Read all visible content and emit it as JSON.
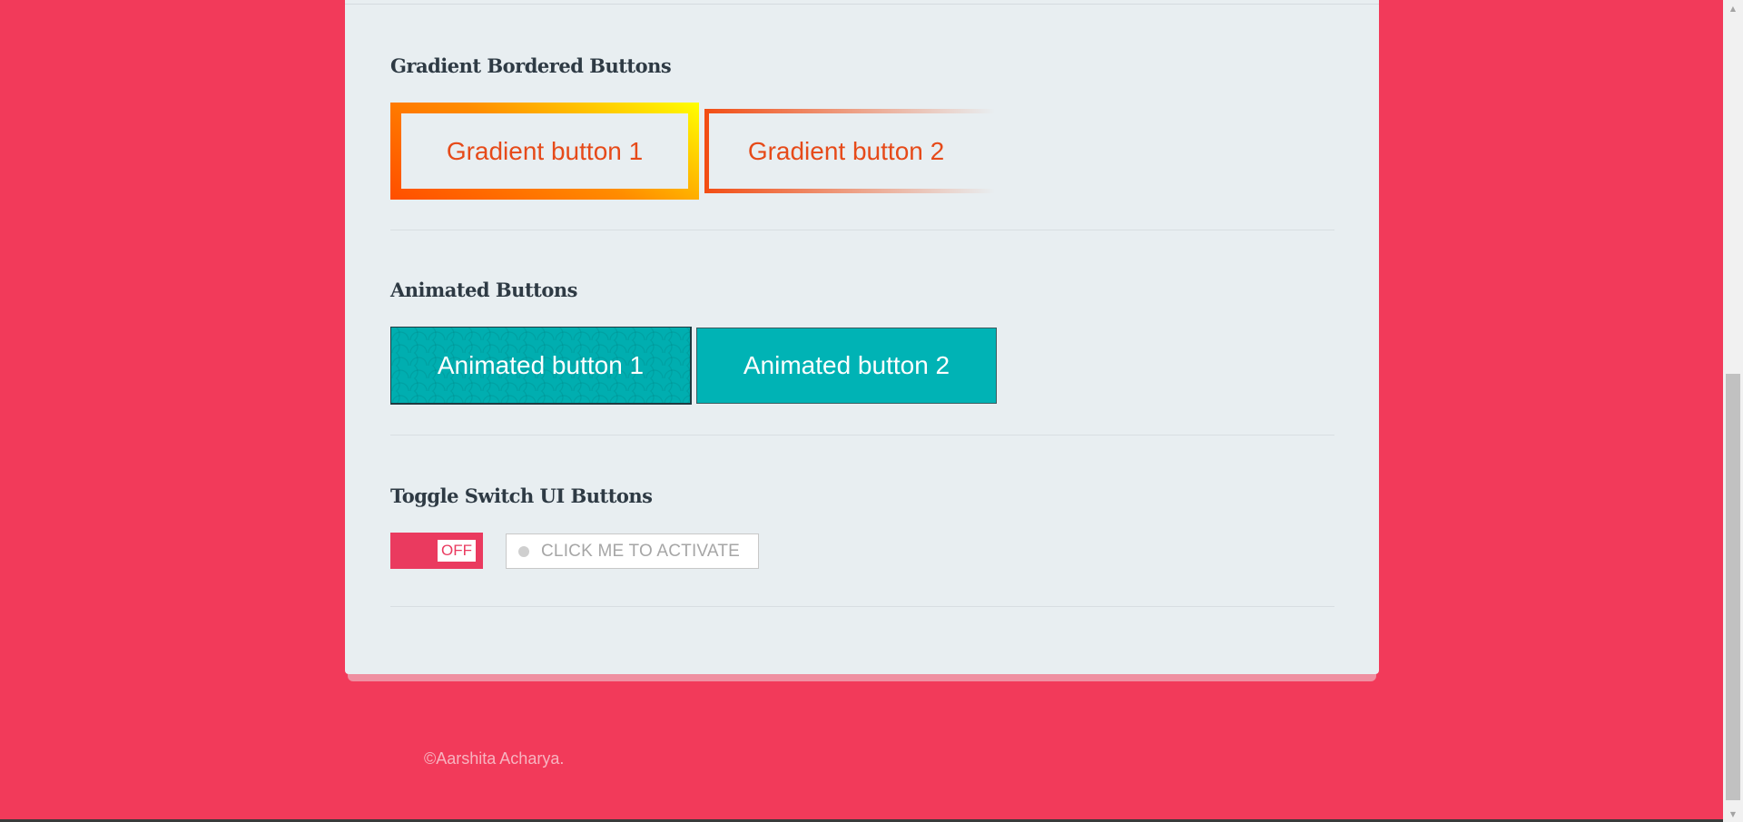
{
  "sections": {
    "gradient": {
      "title": "Gradient Bordered Buttons",
      "button1": "Gradient button 1",
      "button2": "Gradient button 2"
    },
    "animated": {
      "title": "Animated Buttons",
      "button1": "Animated button 1",
      "button2": "Animated button 2"
    },
    "toggle": {
      "title": "Toggle Switch UI Buttons",
      "switch_state": "OFF",
      "activate_label": "CLICK ME TO ACTIVATE"
    }
  },
  "footer": {
    "copyright": "©Aarshita Acharya."
  },
  "colors": {
    "background": "#f23a5a",
    "card": "#e8eef1",
    "accent_orange": "#e64a19",
    "teal": "#00b3b5",
    "toggle_red": "#ea3a5f"
  },
  "icons": {
    "scroll_up": "triangle-up",
    "scroll_down": "triangle-down",
    "activate_dot": "circle"
  }
}
